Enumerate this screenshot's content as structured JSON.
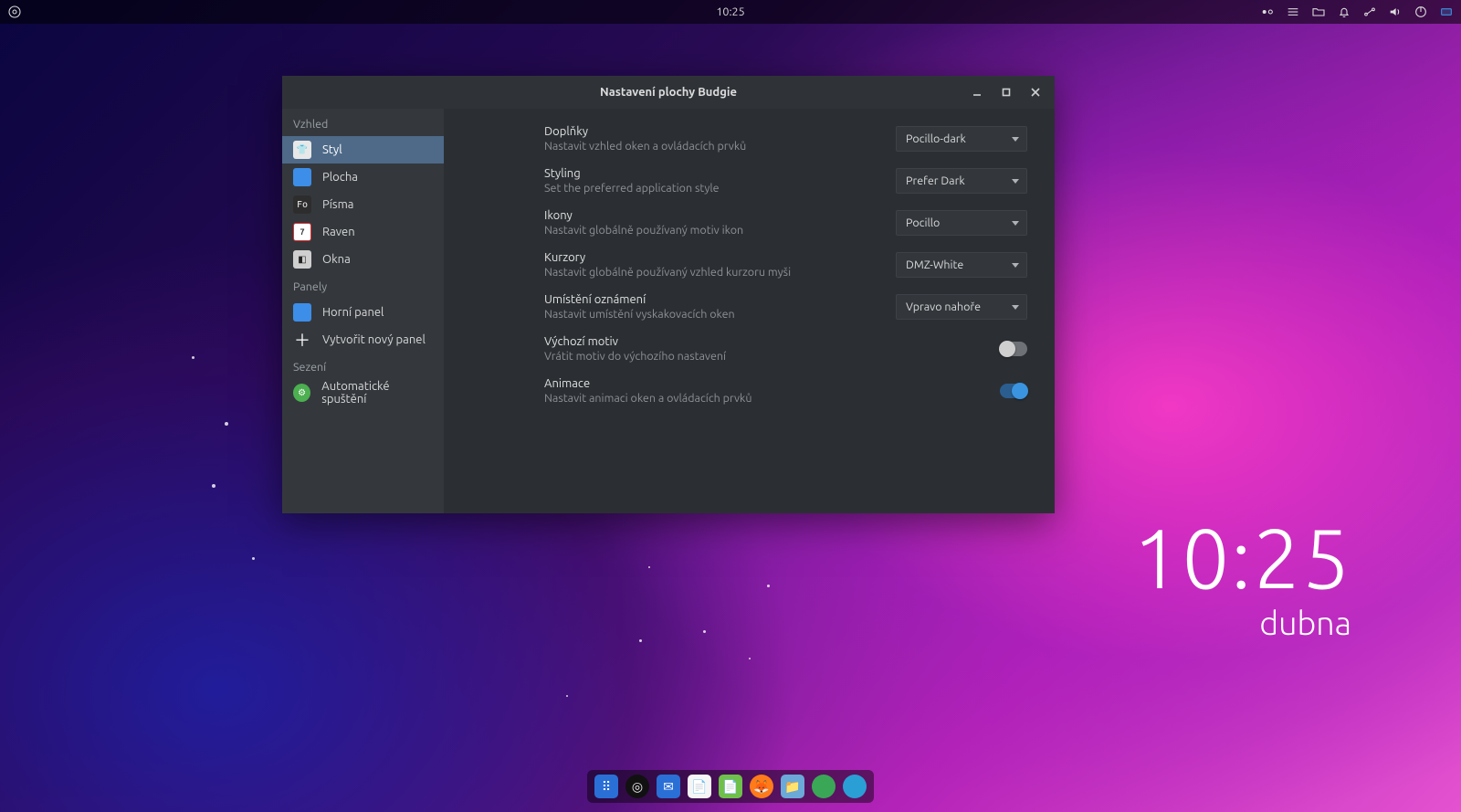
{
  "panel": {
    "clock": "10:25"
  },
  "desktop_clock": {
    "time": "10:25",
    "date": "dubna"
  },
  "window": {
    "title": "Nastavení plochy Budgie",
    "sidebar": {
      "section_appearance": "Vzhled",
      "items_appearance": [
        {
          "label": "Styl"
        },
        {
          "label": "Plocha"
        },
        {
          "label": "Písma"
        },
        {
          "label": "Raven"
        },
        {
          "label": "Okna"
        }
      ],
      "section_panels": "Panely",
      "items_panels": [
        {
          "label": "Horní panel"
        },
        {
          "label": "Vytvořit nový panel"
        }
      ],
      "section_session": "Sezení",
      "items_session": [
        {
          "label": "Automatické spuštění"
        }
      ]
    },
    "settings": {
      "widgets": {
        "title": "Doplňky",
        "desc": "Nastavit vzhled oken a ovládacích prvků",
        "value": "Pocillo-dark"
      },
      "styling": {
        "title": "Styling",
        "desc": "Set the preferred application style",
        "value": "Prefer Dark"
      },
      "icons": {
        "title": "Ikony",
        "desc": "Nastavit globálně používaný motiv ikon",
        "value": "Pocillo"
      },
      "cursors": {
        "title": "Kurzory",
        "desc": "Nastavit globálně používaný vzhled kurzoru myši",
        "value": "DMZ-White"
      },
      "notif": {
        "title": "Umístění oznámení",
        "desc": "Nastavit umístění vyskakovacích oken",
        "value": "Vpravo nahoře"
      },
      "default_theme": {
        "title": "Výchozí motiv",
        "desc": "Vrátit motiv do výchozího nastavení"
      },
      "animations": {
        "title": "Animace",
        "desc": "Nastavit animaci oken a ovládacích prvků"
      }
    }
  }
}
